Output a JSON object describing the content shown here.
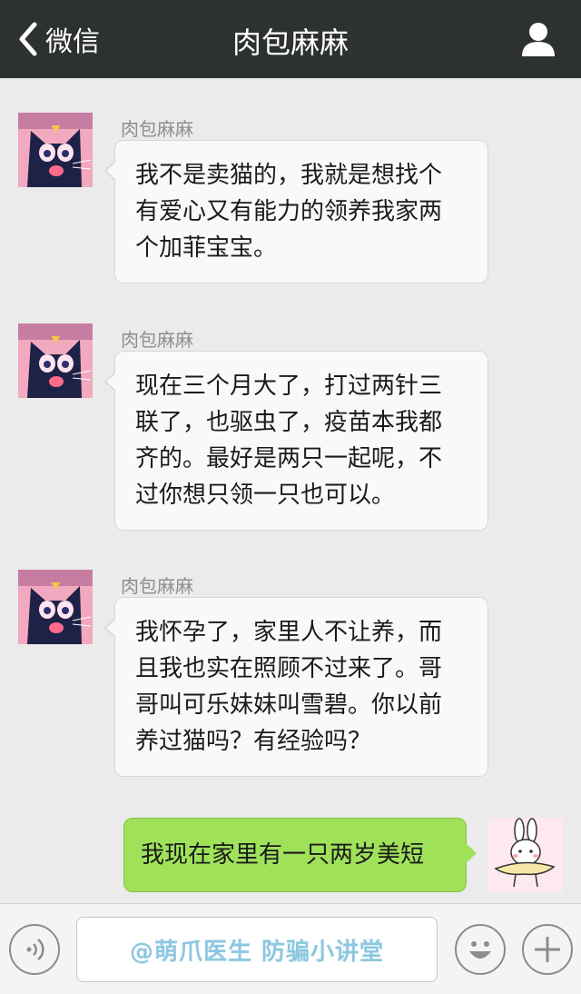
{
  "header": {
    "back_label": "微信",
    "title": "肉包麻麻"
  },
  "messages": [
    {
      "sender": "肉包麻麻",
      "lines": [
        "我不是卖猫的，我就是想找个",
        "有爱心又有能力的领养我家两",
        "个加菲宝宝。"
      ]
    },
    {
      "sender": "肉包麻麻",
      "lines": [
        "现在三个月大了，打过两针三",
        "联了，也驱虫了，疫苗本我都",
        "齐的。最好是两只一起呢，不",
        "过你想只领一只也可以。"
      ]
    },
    {
      "sender": "肉包麻麻",
      "lines": [
        "我怀孕了，家里人不让养，而",
        "且我也实在照顾不过来了。哥",
        "哥叫可乐妹妹叫雪碧。你以前",
        "养过猫吗？有经验吗？"
      ]
    }
  ],
  "outgoing": {
    "text": "我现在家里有一只两岁美短"
  },
  "bottom_bar": {
    "watermark": "@萌爪医生  防骗小讲堂"
  },
  "icons": {
    "back": "chevron-left-icon",
    "profile": "person-icon",
    "voice": "voice-icon",
    "emoji": "emoji-icon",
    "plus": "plus-icon"
  },
  "colors": {
    "header_bg": "#2e3132",
    "outgoing_bubble": "#9fe25a",
    "incoming_bubble": "#f9f9f9",
    "chat_bg": "#ebebeb"
  }
}
